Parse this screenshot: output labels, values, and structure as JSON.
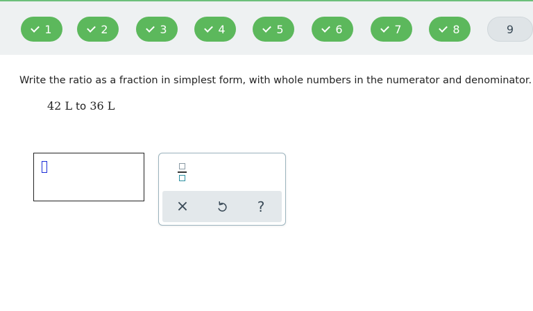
{
  "progress": {
    "questions": [
      {
        "label": "1",
        "status": "correct"
      },
      {
        "label": "2",
        "status": "correct"
      },
      {
        "label": "3",
        "status": "correct"
      },
      {
        "label": "4",
        "status": "correct"
      },
      {
        "label": "5",
        "status": "correct"
      },
      {
        "label": "6",
        "status": "correct"
      },
      {
        "label": "7",
        "status": "correct"
      },
      {
        "label": "8",
        "status": "correct"
      },
      {
        "label": "9",
        "status": "current"
      }
    ]
  },
  "question": {
    "instruction": "Write the ratio as a fraction in simplest form, with whole numbers in the numerator and denominator.",
    "problem_a": "42 L",
    "problem_connector": "to",
    "problem_b": "36 L"
  },
  "answer": {
    "value": ""
  },
  "toolbar": {
    "fraction_icon": "fraction-template-icon",
    "clear_glyph": "×",
    "undo_icon": "undo-icon",
    "help_glyph": "?"
  },
  "colors": {
    "correct": "#5cb85c",
    "current": "#dfe4e7",
    "header_bg": "#eef1f2",
    "caret": "#1a2bd6"
  }
}
